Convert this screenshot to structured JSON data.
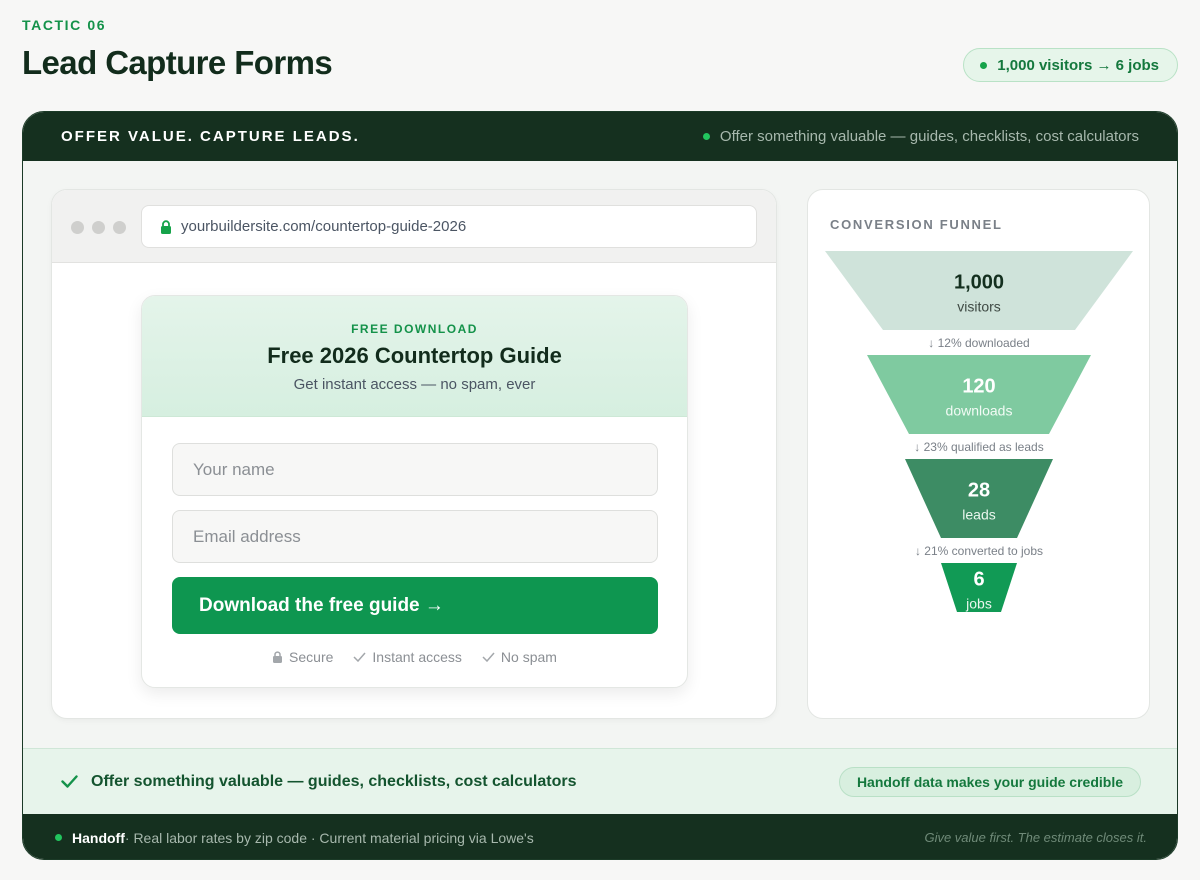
{
  "header": {
    "eyebrow": "TACTIC 06",
    "title": "Lead Capture Forms",
    "stat": "1,000 visitors → 6 jobs"
  },
  "card": {
    "headline": "OFFER VALUE. CAPTURE LEADS.",
    "tip": "Offer something valuable — guides, checklists, cost calculators"
  },
  "browser": {
    "url": "yourbuildersite.com/countertop-guide-2026"
  },
  "form": {
    "eyebrow": "FREE DOWNLOAD",
    "title": "Free 2026 Countertop Guide",
    "subtitle": "Get instant access — no spam, ever",
    "name_placeholder": "Your name",
    "email_placeholder": "Email address",
    "cta_label": "Download the free guide →",
    "trust": [
      "Secure",
      "Instant access",
      "No spam"
    ]
  },
  "funnel": {
    "title": "CONVERSION FUNNEL",
    "stages": [
      {
        "value": "1,000",
        "label": "visitors",
        "color": "#cfe3da"
      },
      {
        "value": "120",
        "label": "downloads",
        "color": "#7fcaa0"
      },
      {
        "value": "28",
        "label": "leads",
        "color": "#3d8c64"
      },
      {
        "value": "6",
        "label": "jobs",
        "color": "#119a55"
      }
    ],
    "rates": [
      "↓ 12% downloaded",
      "↓ 23% qualified as leads",
      "↓ 21% converted to jobs"
    ]
  },
  "strip": {
    "text": "Offer something valuable — guides, checklists, cost calculators",
    "pill": "Handoff data makes your guide credible"
  },
  "footer": {
    "brand": "Handoff",
    "details": " · Real labor rates by zip code · Current material pricing via Lowe's",
    "tagline": "Give value first. The estimate closes it."
  },
  "colors": {
    "accent": "#0e9650",
    "dark": "#15301f",
    "mint": "#e7f4eb"
  }
}
